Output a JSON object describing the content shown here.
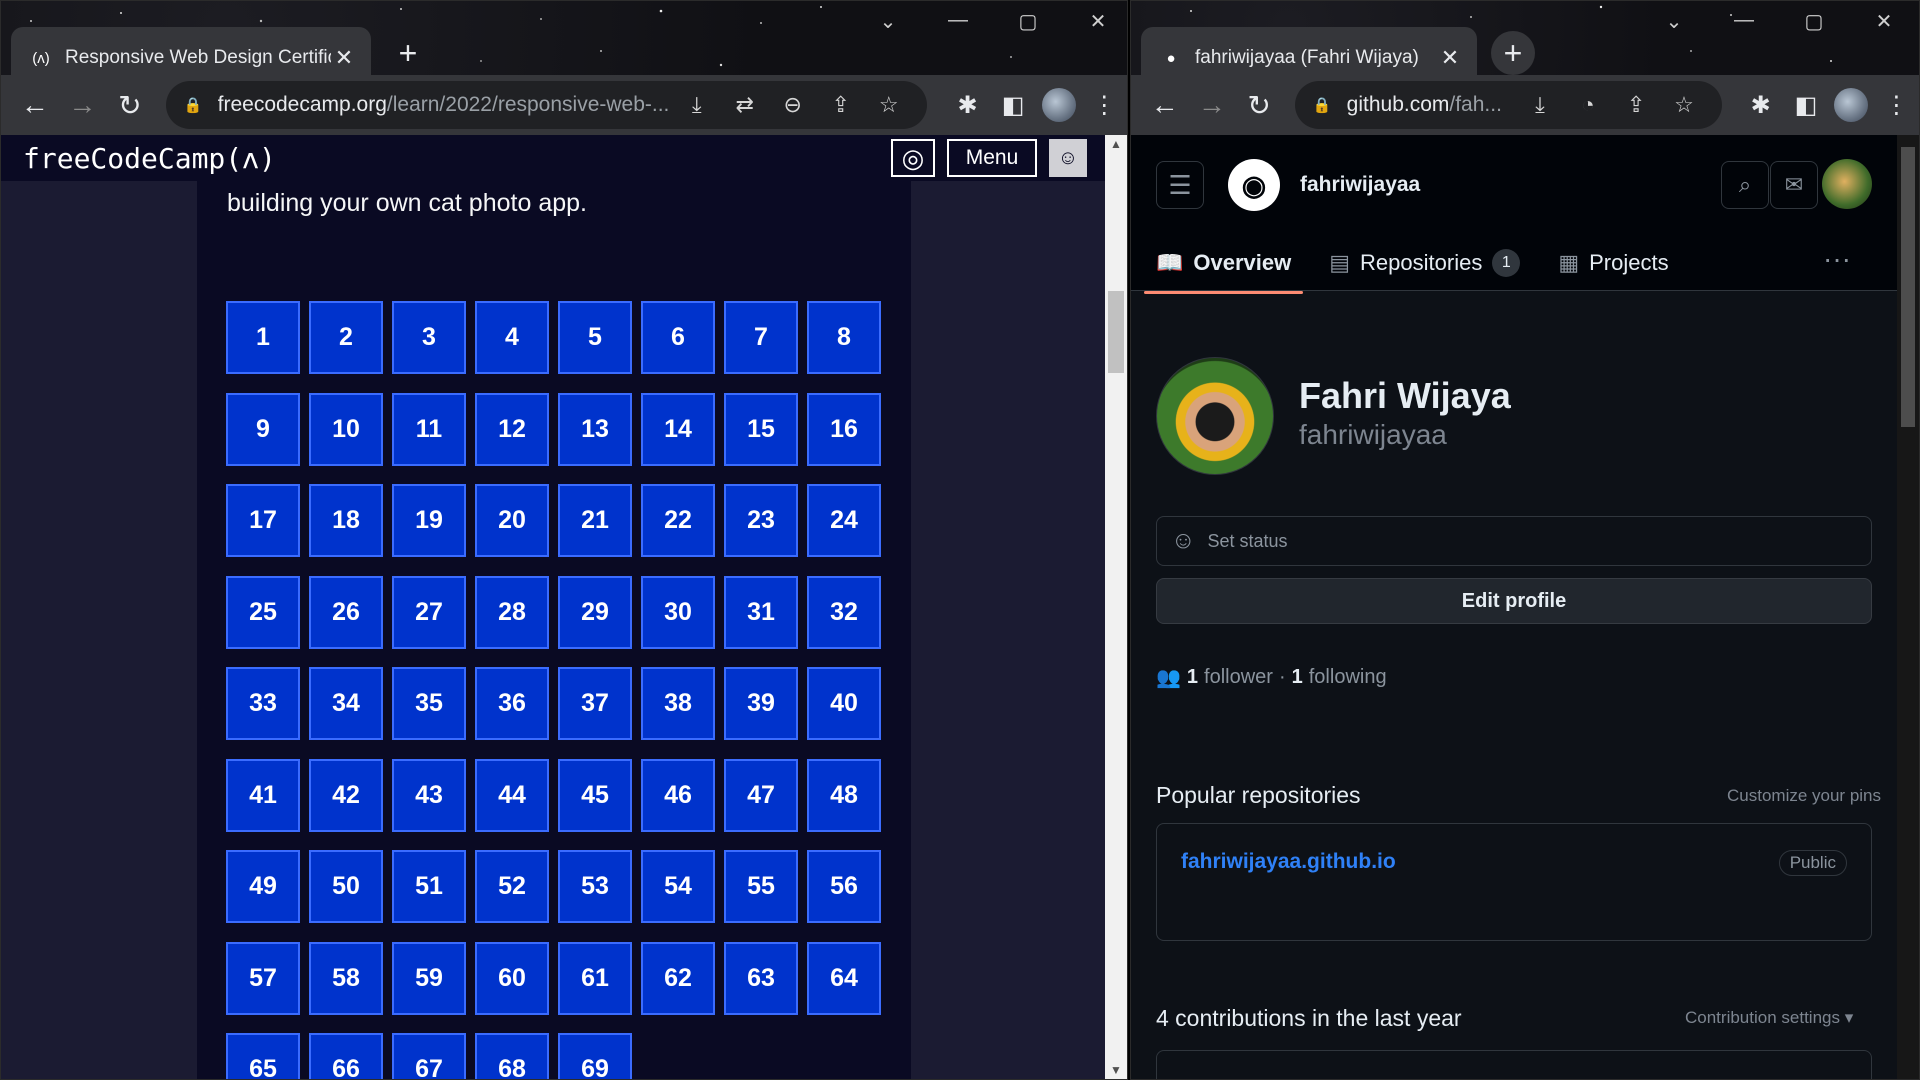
{
  "left_window": {
    "tab": {
      "title": "Responsive Web Design Certificat",
      "favicon": "(ʌ)",
      "close": "✕"
    },
    "new_tab": "+",
    "window_controls": [
      "⌄",
      "—",
      "▢",
      "✕"
    ],
    "url": {
      "host": "freecodecamp.org",
      "path": "/learn/2022/responsive-web-..."
    },
    "fcc": {
      "logo": "freeCodeCamp(ʌ)",
      "menu_label": "Menu",
      "intro": "building your own cat photo app.",
      "steps": [
        "1",
        "2",
        "3",
        "4",
        "5",
        "6",
        "7",
        "8",
        "9",
        "10",
        "11",
        "12",
        "13",
        "14",
        "15",
        "16",
        "17",
        "18",
        "19",
        "20",
        "21",
        "22",
        "23",
        "24",
        "25",
        "26",
        "27",
        "28",
        "29",
        "30",
        "31",
        "32",
        "33",
        "34",
        "35",
        "36",
        "37",
        "38",
        "39",
        "40",
        "41",
        "42",
        "43",
        "44",
        "45",
        "46",
        "47",
        "48",
        "49",
        "50",
        "51",
        "52",
        "53",
        "54",
        "55",
        "56",
        "57",
        "58",
        "59",
        "60",
        "61",
        "62",
        "63",
        "64",
        "65",
        "66",
        "67",
        "68",
        "69"
      ]
    }
  },
  "right_window": {
    "tab": {
      "title": "fahriwijayaa (Fahri Wijaya)",
      "close": "✕"
    },
    "new_tab": "+",
    "window_controls": [
      "⌄",
      "—",
      "▢",
      "✕"
    ],
    "url": {
      "host": "github.com",
      "path": "/fah..."
    },
    "github": {
      "username": "fahriwijayaa",
      "tabs": {
        "overview": "Overview",
        "repositories": "Repositories",
        "repositories_count": "1",
        "projects": "Projects"
      },
      "profile": {
        "name": "Fahri Wijaya",
        "login": "fahriwijayaa"
      },
      "status_placeholder": "Set status",
      "edit_profile": "Edit profile",
      "followers_count": "1",
      "followers_label": "follower",
      "separator": "·",
      "following_count": "1",
      "following_label": "following",
      "popular_title": "Popular repositories",
      "customize_pins": "Customize your pins",
      "repo": {
        "name": "fahriwijayaa.github.io",
        "visibility": "Public"
      },
      "contributions_title": "4 contributions in the last year",
      "contribution_settings": "Contribution settings ▾"
    }
  },
  "colors": {
    "fcc_step": "#0033cc",
    "github_link": "#2f81f7",
    "active_tab_underline": "#fd8c73"
  }
}
